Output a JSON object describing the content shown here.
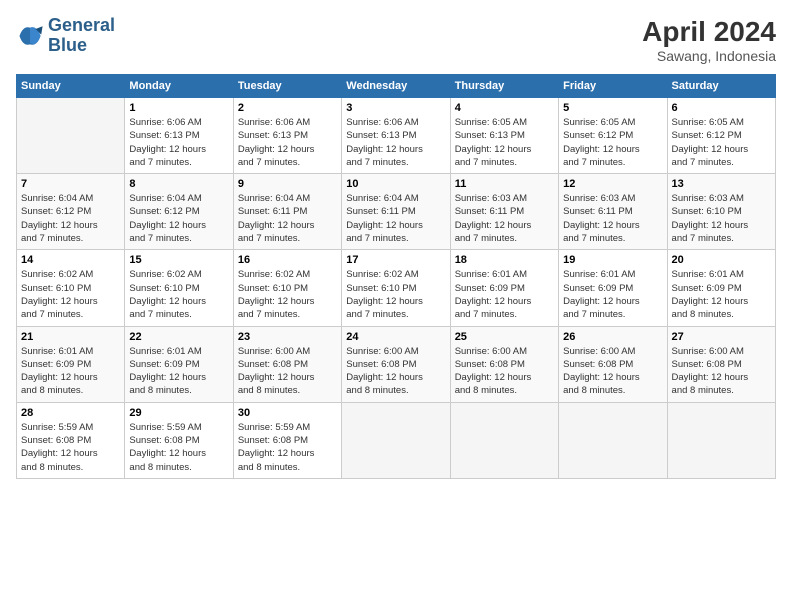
{
  "header": {
    "logo_line1": "General",
    "logo_line2": "Blue",
    "title": "April 2024",
    "subtitle": "Sawang, Indonesia"
  },
  "columns": [
    "Sunday",
    "Monday",
    "Tuesday",
    "Wednesday",
    "Thursday",
    "Friday",
    "Saturday"
  ],
  "weeks": [
    [
      {
        "day": "",
        "info": ""
      },
      {
        "day": "1",
        "info": "Sunrise: 6:06 AM\nSunset: 6:13 PM\nDaylight: 12 hours\nand 7 minutes."
      },
      {
        "day": "2",
        "info": "Sunrise: 6:06 AM\nSunset: 6:13 PM\nDaylight: 12 hours\nand 7 minutes."
      },
      {
        "day": "3",
        "info": "Sunrise: 6:06 AM\nSunset: 6:13 PM\nDaylight: 12 hours\nand 7 minutes."
      },
      {
        "day": "4",
        "info": "Sunrise: 6:05 AM\nSunset: 6:13 PM\nDaylight: 12 hours\nand 7 minutes."
      },
      {
        "day": "5",
        "info": "Sunrise: 6:05 AM\nSunset: 6:12 PM\nDaylight: 12 hours\nand 7 minutes."
      },
      {
        "day": "6",
        "info": "Sunrise: 6:05 AM\nSunset: 6:12 PM\nDaylight: 12 hours\nand 7 minutes."
      }
    ],
    [
      {
        "day": "7",
        "info": "Sunrise: 6:04 AM\nSunset: 6:12 PM\nDaylight: 12 hours\nand 7 minutes."
      },
      {
        "day": "8",
        "info": "Sunrise: 6:04 AM\nSunset: 6:12 PM\nDaylight: 12 hours\nand 7 minutes."
      },
      {
        "day": "9",
        "info": "Sunrise: 6:04 AM\nSunset: 6:11 PM\nDaylight: 12 hours\nand 7 minutes."
      },
      {
        "day": "10",
        "info": "Sunrise: 6:04 AM\nSunset: 6:11 PM\nDaylight: 12 hours\nand 7 minutes."
      },
      {
        "day": "11",
        "info": "Sunrise: 6:03 AM\nSunset: 6:11 PM\nDaylight: 12 hours\nand 7 minutes."
      },
      {
        "day": "12",
        "info": "Sunrise: 6:03 AM\nSunset: 6:11 PM\nDaylight: 12 hours\nand 7 minutes."
      },
      {
        "day": "13",
        "info": "Sunrise: 6:03 AM\nSunset: 6:10 PM\nDaylight: 12 hours\nand 7 minutes."
      }
    ],
    [
      {
        "day": "14",
        "info": "Sunrise: 6:02 AM\nSunset: 6:10 PM\nDaylight: 12 hours\nand 7 minutes."
      },
      {
        "day": "15",
        "info": "Sunrise: 6:02 AM\nSunset: 6:10 PM\nDaylight: 12 hours\nand 7 minutes."
      },
      {
        "day": "16",
        "info": "Sunrise: 6:02 AM\nSunset: 6:10 PM\nDaylight: 12 hours\nand 7 minutes."
      },
      {
        "day": "17",
        "info": "Sunrise: 6:02 AM\nSunset: 6:10 PM\nDaylight: 12 hours\nand 7 minutes."
      },
      {
        "day": "18",
        "info": "Sunrise: 6:01 AM\nSunset: 6:09 PM\nDaylight: 12 hours\nand 7 minutes."
      },
      {
        "day": "19",
        "info": "Sunrise: 6:01 AM\nSunset: 6:09 PM\nDaylight: 12 hours\nand 7 minutes."
      },
      {
        "day": "20",
        "info": "Sunrise: 6:01 AM\nSunset: 6:09 PM\nDaylight: 12 hours\nand 8 minutes."
      }
    ],
    [
      {
        "day": "21",
        "info": "Sunrise: 6:01 AM\nSunset: 6:09 PM\nDaylight: 12 hours\nand 8 minutes."
      },
      {
        "day": "22",
        "info": "Sunrise: 6:01 AM\nSunset: 6:09 PM\nDaylight: 12 hours\nand 8 minutes."
      },
      {
        "day": "23",
        "info": "Sunrise: 6:00 AM\nSunset: 6:08 PM\nDaylight: 12 hours\nand 8 minutes."
      },
      {
        "day": "24",
        "info": "Sunrise: 6:00 AM\nSunset: 6:08 PM\nDaylight: 12 hours\nand 8 minutes."
      },
      {
        "day": "25",
        "info": "Sunrise: 6:00 AM\nSunset: 6:08 PM\nDaylight: 12 hours\nand 8 minutes."
      },
      {
        "day": "26",
        "info": "Sunrise: 6:00 AM\nSunset: 6:08 PM\nDaylight: 12 hours\nand 8 minutes."
      },
      {
        "day": "27",
        "info": "Sunrise: 6:00 AM\nSunset: 6:08 PM\nDaylight: 12 hours\nand 8 minutes."
      }
    ],
    [
      {
        "day": "28",
        "info": "Sunrise: 5:59 AM\nSunset: 6:08 PM\nDaylight: 12 hours\nand 8 minutes."
      },
      {
        "day": "29",
        "info": "Sunrise: 5:59 AM\nSunset: 6:08 PM\nDaylight: 12 hours\nand 8 minutes."
      },
      {
        "day": "30",
        "info": "Sunrise: 5:59 AM\nSunset: 6:08 PM\nDaylight: 12 hours\nand 8 minutes."
      },
      {
        "day": "",
        "info": ""
      },
      {
        "day": "",
        "info": ""
      },
      {
        "day": "",
        "info": ""
      },
      {
        "day": "",
        "info": ""
      }
    ]
  ]
}
